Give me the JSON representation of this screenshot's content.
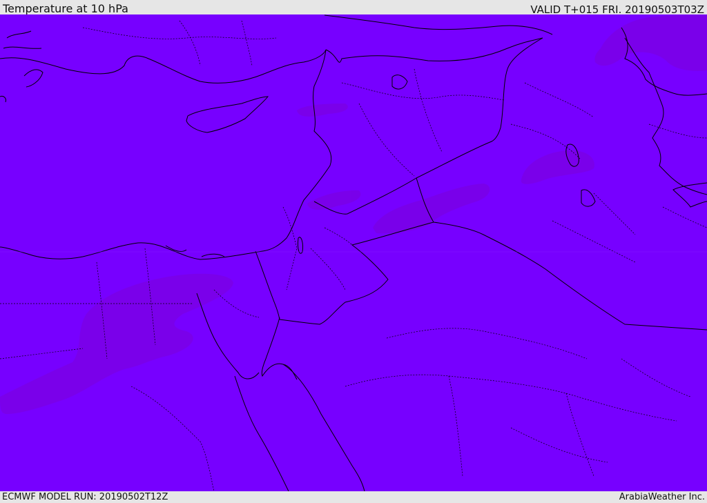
{
  "header": {
    "title": "Temperature at 10 hPa",
    "valid_time": "VALID T+015 FRI. 20190503T03Z"
  },
  "footer": {
    "model_run": "ECMWF MODEL RUN: 20190502T12Z",
    "credit": "ArabiaWeather Inc."
  },
  "map": {
    "field_colors": {
      "background": "#7700ff",
      "patch": "#7a00e6",
      "border": "#000000"
    }
  }
}
